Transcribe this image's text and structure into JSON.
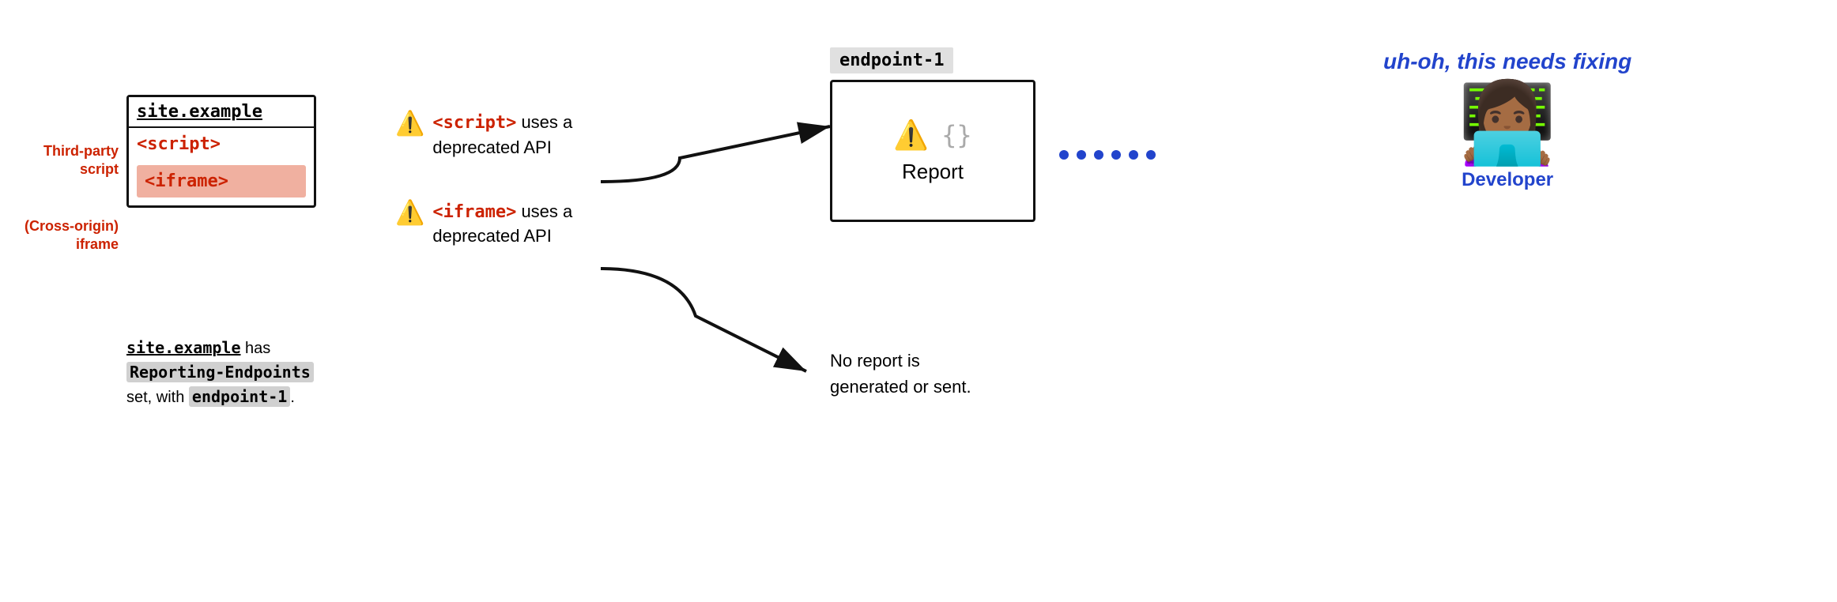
{
  "site_box": {
    "title": "site.example",
    "script_label": "<script>",
    "iframe_label": "<iframe>"
  },
  "labels": {
    "third_party": "Third-party\nscript",
    "cross_origin": "(Cross-origin)\niframe"
  },
  "caption": {
    "mono_text": "site.example",
    "rest_text": " has",
    "line2_plain": "Reporting-Endpoints",
    "line3_plain": "set, with",
    "highlight_text": "endpoint-1",
    "period": "."
  },
  "warnings": [
    {
      "icon": "⚠️",
      "tag": "<script>",
      "text": " uses a\ndeprecated API"
    },
    {
      "icon": "⚠️",
      "tag": "<iframe>",
      "text": " uses a\ndeprecated API"
    }
  ],
  "endpoint": {
    "label": "endpoint-1",
    "warning_icon": "⚠️",
    "json_icon": "{}",
    "report_text": "Report"
  },
  "no_report": {
    "text": "No report is\ngenerated or sent."
  },
  "developer": {
    "uh_oh_text": "uh-oh,\nthis\nneeds\nfixing",
    "emoji": "👩🏾‍💻",
    "label": "Developer"
  },
  "dots": [
    "•",
    "•",
    "•",
    "•",
    "•",
    "•"
  ]
}
